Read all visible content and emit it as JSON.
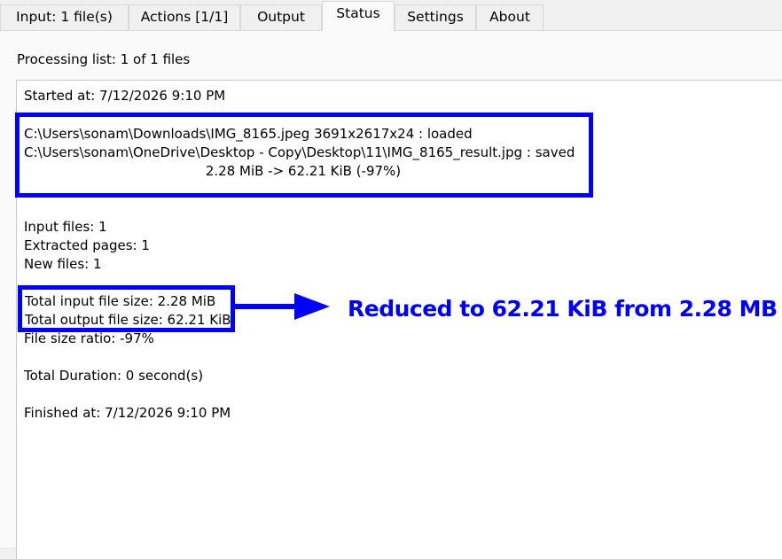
{
  "tabs": [
    {
      "label": "Input: 1 file(s)"
    },
    {
      "label": "Actions [1/1]"
    },
    {
      "label": "Output"
    },
    {
      "label": "Status",
      "active": true
    },
    {
      "label": "Settings"
    },
    {
      "label": "About"
    }
  ],
  "status": {
    "processing_list": "Processing list:  1 of 1 files",
    "started_at": "Started at: 7/12/2026 9:10 PM",
    "log": [
      "C:\\Users\\sonam\\Downloads\\IMG_8165.jpeg 3691x2617x24 : loaded",
      "C:\\Users\\sonam\\OneDrive\\Desktop - Copy\\Desktop\\11\\IMG_8165_result.jpg : saved",
      "2.28 MiB -> 62.21 KiB (-97%)"
    ],
    "input_files": "Input files: 1",
    "extracted_pages": "Extracted pages: 1",
    "new_files": "New files: 1",
    "total_input_size": "Total input file size: 2.28 MiB",
    "total_output_size": "Total output file size: 62.21 KiB",
    "file_size_ratio": "File size ratio: -97%",
    "total_duration": "Total Duration: 0 second(s)",
    "finished_at": "Finished at: 7/12/2026 9:10 PM"
  },
  "annotation": {
    "text": "Reduced to 62.21 KiB from 2.28 MB",
    "color": "#0000ff"
  }
}
